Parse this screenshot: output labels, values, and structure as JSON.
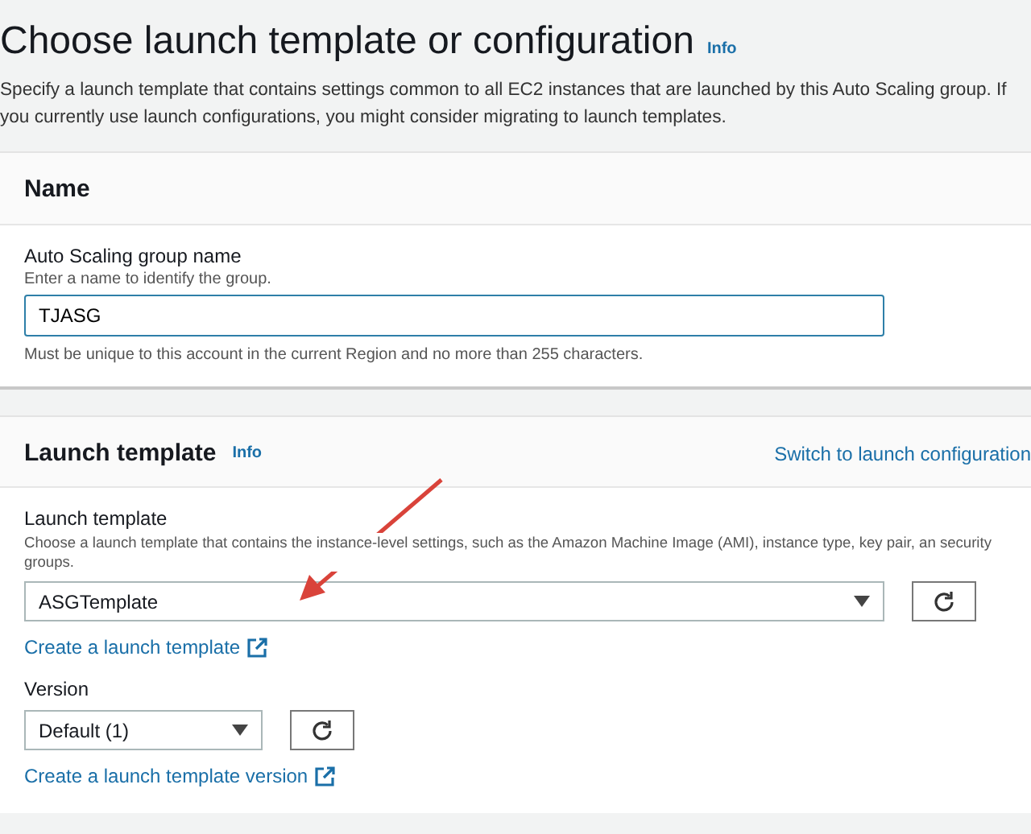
{
  "page": {
    "title": "Choose launch template or configuration",
    "info": "Info",
    "description": "Specify a launch template that contains settings common to all EC2 instances that are launched by this Auto Scaling group. If you currently use launch configurations, you might consider migrating to launch templates."
  },
  "name_section": {
    "title": "Name",
    "field_label": "Auto Scaling group name",
    "field_hint": "Enter a name to identify the group.",
    "value": "TJASG",
    "constraint": "Must be unique to this account in the current Region and no more than 255 characters."
  },
  "template_section": {
    "title": "Launch template",
    "info": "Info",
    "switch_link": "Switch to launch configuration",
    "template_label": "Launch template",
    "template_hint": "Choose a launch template that contains the instance-level settings, such as the Amazon Machine Image (AMI), instance type, key pair, an security groups.",
    "template_value": "ASGTemplate",
    "create_link": "Create a launch template",
    "version_label": "Version",
    "version_value": "Default (1)",
    "create_version_link": "Create a launch template version"
  }
}
